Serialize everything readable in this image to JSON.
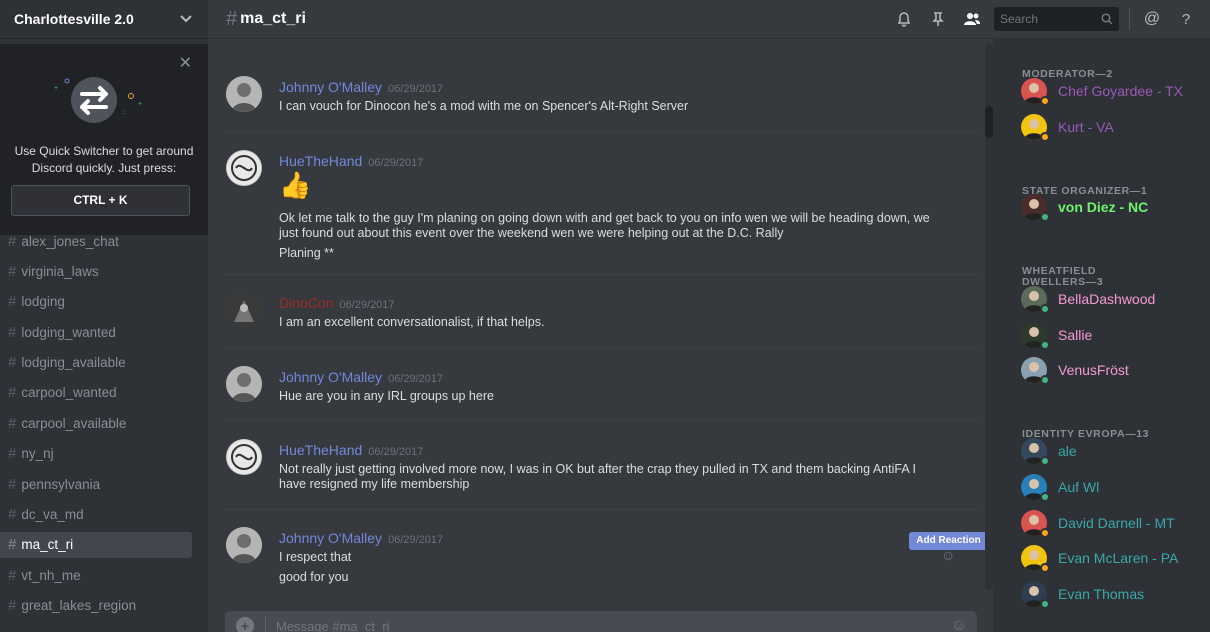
{
  "server": {
    "name": "Charlottesville 2.0"
  },
  "quick_switcher": {
    "line1": "Use Quick Switcher to get around",
    "line2": "Discord quickly. Just press:",
    "shortcut": "CTRL + K"
  },
  "channels": [
    {
      "name": "alex_jones_chat"
    },
    {
      "name": "virginia_laws"
    },
    {
      "name": "lodging"
    },
    {
      "name": "lodging_wanted"
    },
    {
      "name": "lodging_available"
    },
    {
      "name": "carpool_wanted"
    },
    {
      "name": "carpool_available"
    },
    {
      "name": "ny_nj"
    },
    {
      "name": "pennsylvania"
    },
    {
      "name": "dc_va_md"
    },
    {
      "name": "ma_ct_ri"
    },
    {
      "name": "vt_nh_me"
    },
    {
      "name": "great_lakes_region"
    }
  ],
  "active_channel": "ma_ct_ri",
  "header": {
    "hash": "#",
    "channel": "ma_ct_ri",
    "search_placeholder": "Search"
  },
  "messages": [
    {
      "author": "Johnny O'Malley",
      "color": "#7289da",
      "time": "06/29/2017",
      "lines": [
        "I can vouch for Dinocon he's a mod with me on Spencer's Alt-Right Server"
      ]
    },
    {
      "author": "HueTheHand",
      "color": "#7289da",
      "time": "06/29/2017",
      "emoji": "👍",
      "lines": [
        "Ok let me talk to the guy I'm planing on going down with and get back to you on info wen we will be heading down, we",
        "just found out about this event over the weekend wen we were helping out at the D.C. Rally",
        "Planing **"
      ]
    },
    {
      "author": "DinoCon",
      "color": "#992d22",
      "time": "06/29/2017",
      "lines": [
        "I am an excellent conversationalist, if that helps."
      ]
    },
    {
      "author": "Johnny O'Malley",
      "color": "#7289da",
      "time": "06/29/2017",
      "lines": [
        "Hue are you in any IRL groups up here"
      ]
    },
    {
      "author": "HueTheHand",
      "color": "#7289da",
      "time": "06/29/2017",
      "lines": [
        "Not really just getting involved more now, I was in OK but after the crap they pulled in TX and them backing AntiFA I",
        "have resigned my life membership"
      ]
    },
    {
      "author": "Johnny O'Malley",
      "color": "#7289da",
      "time": "06/29/2017",
      "lines": [
        "I respect that",
        "good for you"
      ]
    }
  ],
  "add_reaction_label": "Add Reaction",
  "composer": {
    "placeholder": "Message #ma_ct_ri"
  },
  "member_groups": [
    {
      "title": "MODERATOR—2",
      "members": [
        {
          "name": "Chef Goyardee - TX",
          "color": "#9b59b6",
          "status": "#faa61a"
        },
        {
          "name": "Kurt - VA",
          "color": "#9b59b6",
          "status": "#faa61a"
        }
      ]
    },
    {
      "title": "STATE ORGANIZER—1",
      "members": [
        {
          "name": "von Diez - NC",
          "color": "#6ef46e",
          "status": "#43b581"
        }
      ]
    },
    {
      "title": "WHEATFIELD DWELLERS—3",
      "title_line1": "WHEATFIELD",
      "title_line2": "DWELLERS—3",
      "members": [
        {
          "name": "BellaDashwood",
          "color": "#f59ad6",
          "status": "#43b581"
        },
        {
          "name": "Sallie",
          "color": "#f59ad6",
          "status": "#43b581"
        },
        {
          "name": "VenusFröst",
          "color": "#f59ad6",
          "status": "#43b581"
        }
      ]
    },
    {
      "title": "IDENTITY EVROPA—13",
      "members": [
        {
          "name": "ale",
          "color": "#3aa8a8",
          "status": "#43b581"
        },
        {
          "name": "Auf Wl",
          "color": "#3aa8a8",
          "status": "#43b581"
        },
        {
          "name": "David Darnell - MT",
          "color": "#3aa8a8",
          "status": "#faa61a"
        },
        {
          "name": "Evan McLaren - PA",
          "color": "#3aa8a8",
          "status": "#faa61a"
        },
        {
          "name": "Evan Thomas",
          "color": "#3aa8a8",
          "status": "#43b581"
        }
      ]
    }
  ]
}
